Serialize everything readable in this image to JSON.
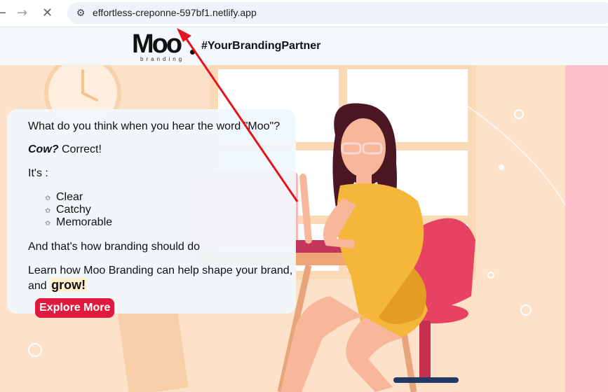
{
  "browser": {
    "url": "effortless-creponne-597bf1.netlify.app",
    "back_glyph": "←",
    "forward_glyph": "→",
    "stop_glyph": "✕",
    "site_info_glyph": "⚙"
  },
  "header": {
    "logo_text": "Moo",
    "logo_subtext": "branding",
    "tagline": "#YourBrandingPartner"
  },
  "card": {
    "question": "What do you think when you hear the word \"Moo\"?",
    "cow_bold": "Cow?",
    "cow_rest": " Correct!",
    "its_label": "It's :",
    "bullet_glyph": "✩",
    "qualities": [
      "Clear",
      "Catchy",
      "Memorable"
    ],
    "branding_line": "And that's how branding should do",
    "learn_line": "Learn how Moo Branding can help shape your brand, and",
    "grow_word": "grow!",
    "cta_label": "Explore More"
  },
  "colors": {
    "cta": "#e0193f",
    "annotation_arrow": "#e3141e",
    "hero_bg": "#fde1c8",
    "side_strip": "#ffc0cc"
  },
  "icons": [
    "back-arrow-icon",
    "forward-arrow-icon",
    "stop-icon",
    "site-info-icon",
    "star-bullet-icon"
  ]
}
